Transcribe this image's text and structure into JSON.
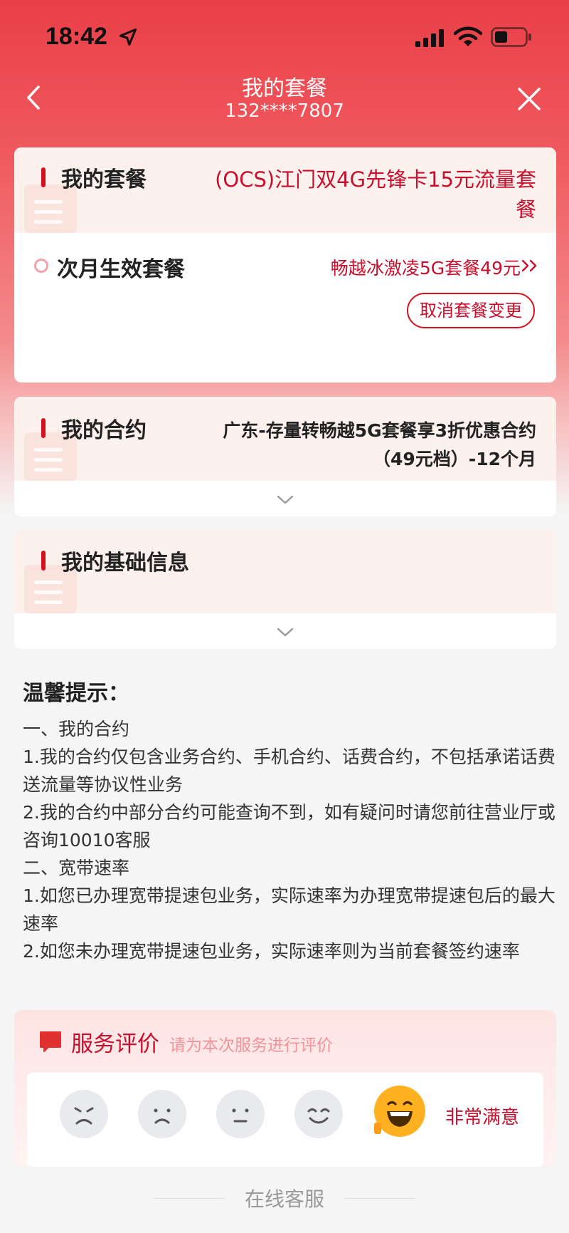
{
  "status_bar": {
    "time": "18:42"
  },
  "nav": {
    "title": "我的套餐",
    "subtitle": "132****7807"
  },
  "plan_card": {
    "title": "我的套餐",
    "value": "(OCS)江门双4G先锋卡15元流量套餐",
    "next_label": "次月生效套餐",
    "next_value": "畅越冰激凌5G套餐49元",
    "cancel_button": "取消套餐变更"
  },
  "contract_card": {
    "title": "我的合约",
    "value": "广东-存量转畅越5G套餐享3折优惠合约（49元档）-12个月"
  },
  "basic_card": {
    "title": "我的基础信息"
  },
  "tips": {
    "title": "温馨提示：",
    "lines": [
      "一、我的合约",
      "1.我的合约仅包含业务合约、手机合约、话费合约，不包括承诺话费送流量等协议性业务",
      "2.我的合约中部分合约可能查询不到，如有疑问时请您前往营业厅或咨询10010客服",
      "二、宽带速率",
      "1.如您已办理宽带提速包业务，实际速率为办理宽带提速包后的最大速率",
      "2.如您未办理宽带提速包业务，实际速率则为当前套餐签约速率"
    ]
  },
  "rating": {
    "title": "服务评价",
    "hint": "请为本次服务进行评价",
    "selected_label": "非常满意",
    "accent_color": "#c8102e"
  },
  "bottom": {
    "service_link": "在线客服"
  }
}
